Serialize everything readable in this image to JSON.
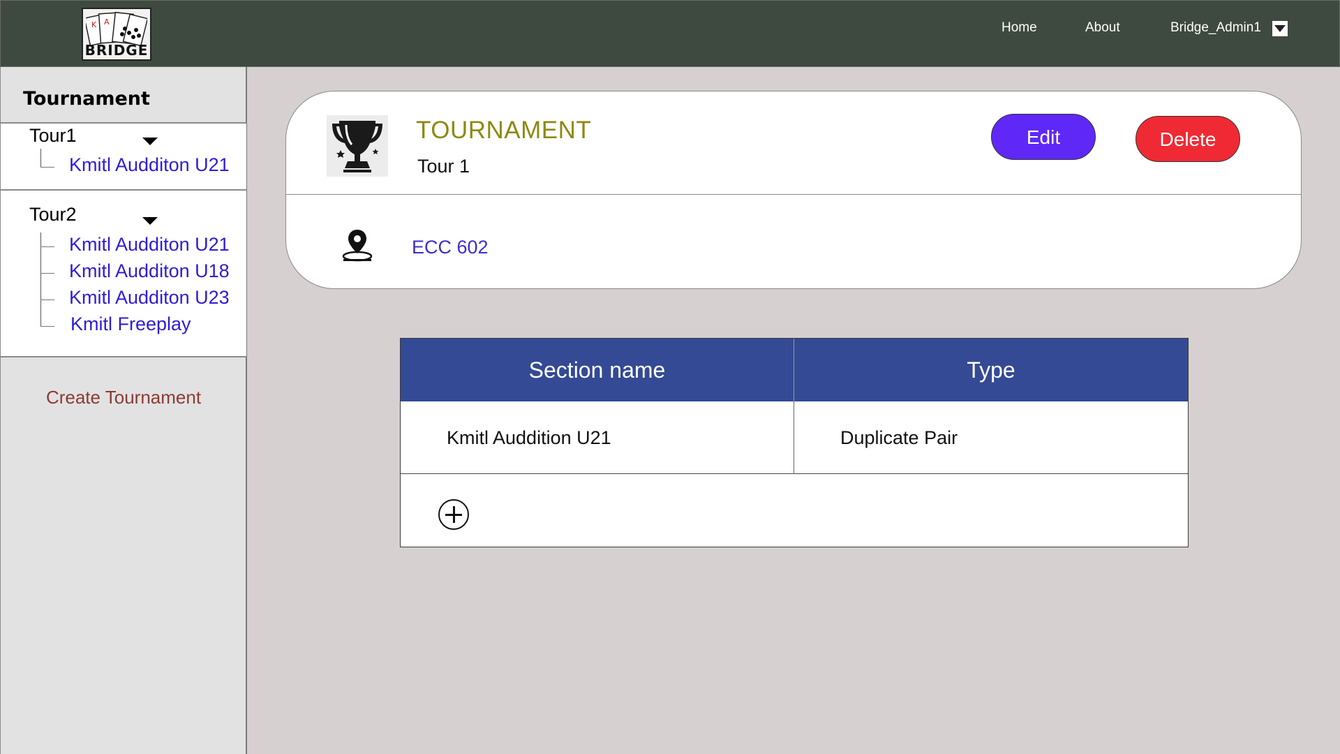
{
  "header": {
    "logo_text": "BRIDGE",
    "nav": {
      "home": "Home",
      "about": "About",
      "user": "Bridge_Admin1"
    }
  },
  "sidebar": {
    "title": "Tournament",
    "tours": [
      {
        "label": "Tour1",
        "sections": [
          "Kmitl Audditon U21"
        ]
      },
      {
        "label": "Tour2",
        "sections": [
          "Kmitl Audditon U21",
          "Kmitl Audditon U18",
          "Kmitl Audditon U23",
          "Kmitl Freeplay"
        ]
      }
    ],
    "create_label": "Create Tournament"
  },
  "tournament": {
    "heading": "TOURNAMENT",
    "name": "Tour 1",
    "location": "ECC 602",
    "edit_label": "Edit",
    "delete_label": "Delete"
  },
  "sections_table": {
    "headers": [
      "Section name",
      "Type"
    ],
    "rows": [
      [
        "Kmitl Auddition U21",
        "Duplicate Pair"
      ]
    ]
  },
  "colors": {
    "topbar": "#3e4a3f",
    "accent_edit": "#5f28f7",
    "accent_delete": "#f02a34",
    "table_header": "#344a94",
    "link": "#2e1dd6",
    "heading": "#8c8a12"
  }
}
